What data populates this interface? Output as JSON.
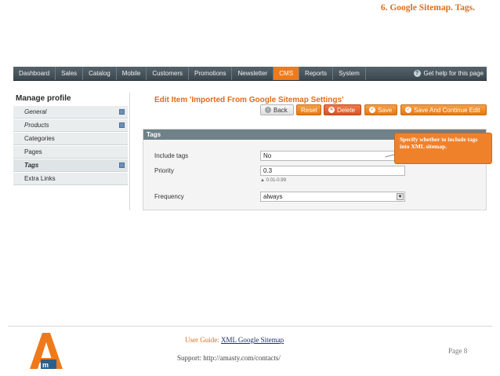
{
  "doc": {
    "title": "6. Google Sitemap. Tags.",
    "guide_prefix": "User Guide:",
    "guide_link": "XML Google Sitemap",
    "support": "Support: http://amasty.com/contacts/",
    "page": "Page 8"
  },
  "nav": {
    "items": [
      "Dashboard",
      "Sales",
      "Catalog",
      "Mobile",
      "Customers",
      "Promotions",
      "Newsletter",
      "CMS",
      "Reports",
      "System"
    ],
    "active": "CMS",
    "help": "Get help for this page"
  },
  "sidebar": {
    "title": "Manage profile",
    "items": [
      {
        "label": "General"
      },
      {
        "label": "Products"
      },
      {
        "label": "Categories"
      },
      {
        "label": "Pages"
      },
      {
        "label": "Tags"
      },
      {
        "label": "Extra Links"
      }
    ]
  },
  "content": {
    "title": "Edit Item 'Imported From Google Sitemap Settings'",
    "buttons": {
      "back": "Back",
      "reset": "Reset",
      "delete": "Delete",
      "save": "Save",
      "save_continue": "Save And Continue Edit"
    }
  },
  "panel": {
    "title": "Tags",
    "include_tags_label": "Include tags",
    "include_tags_value": "No",
    "priority_label": "Priority",
    "priority_value": "0.3",
    "priority_note": "0.01-0.99",
    "frequency_label": "Frequency",
    "frequency_value": "always"
  },
  "tooltip": {
    "text": "Specify whether to include tags into XML sitemap."
  },
  "colors": {
    "accent": "#ef7a1b",
    "nav_bg": "#3b474e",
    "panel_head": "#6f8189"
  }
}
